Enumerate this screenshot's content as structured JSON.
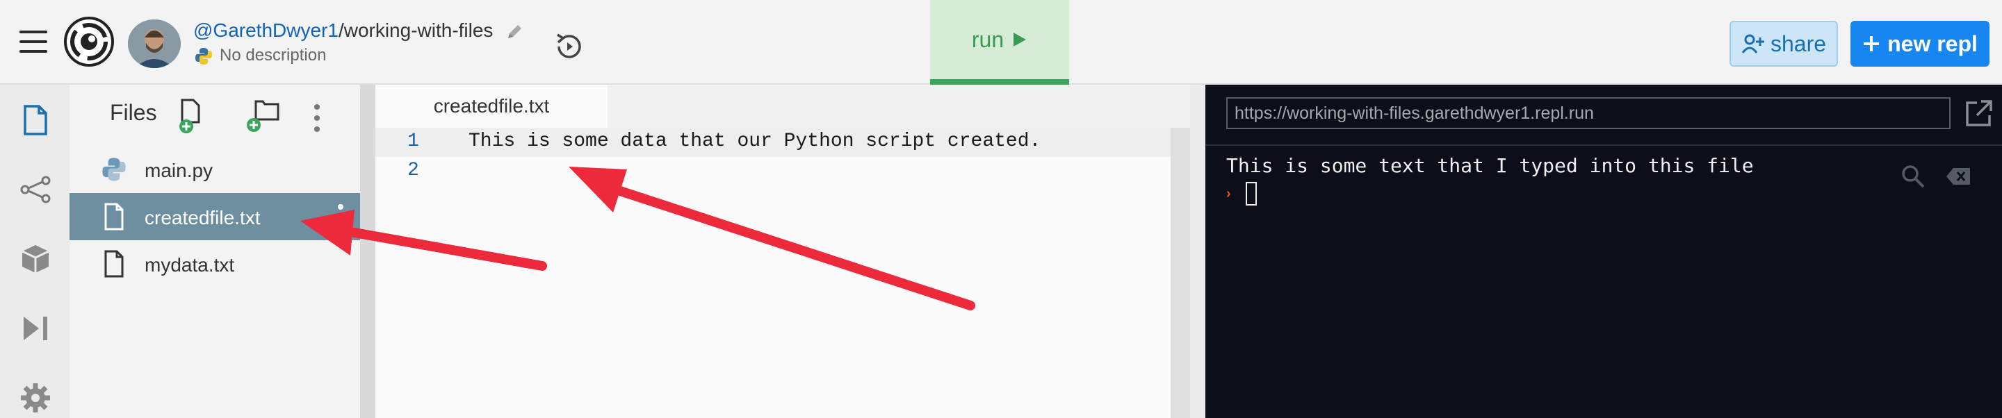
{
  "header": {
    "owner": "@GarethDwyer1",
    "separator": "/",
    "repl_name": "working-with-files",
    "description": "No description",
    "run_label": "run",
    "share_label": "share",
    "new_repl_label": "new repl"
  },
  "files_panel": {
    "title": "Files",
    "items": [
      {
        "name": "main.py",
        "icon": "python-icon"
      },
      {
        "name": "createdfile.txt",
        "icon": "file-icon"
      },
      {
        "name": "mydata.txt",
        "icon": "file-icon"
      }
    ]
  },
  "editor": {
    "tab_label": "createdfile.txt",
    "lines": [
      {
        "number": "1",
        "text": "This is some data that our Python script created."
      },
      {
        "number": "2",
        "text": ""
      }
    ]
  },
  "console": {
    "url": "https://working-with-files.garethdwyer1.repl.run",
    "output": "This is some text that I typed into this file",
    "prompt": "›"
  },
  "colors": {
    "run_green": "#3a9a51",
    "accent_blue": "#1886f0",
    "selected_file_bg": "#6e8fa0",
    "console_bg": "#0c0f1a",
    "annotation_arrow": "#ec2a3c"
  }
}
